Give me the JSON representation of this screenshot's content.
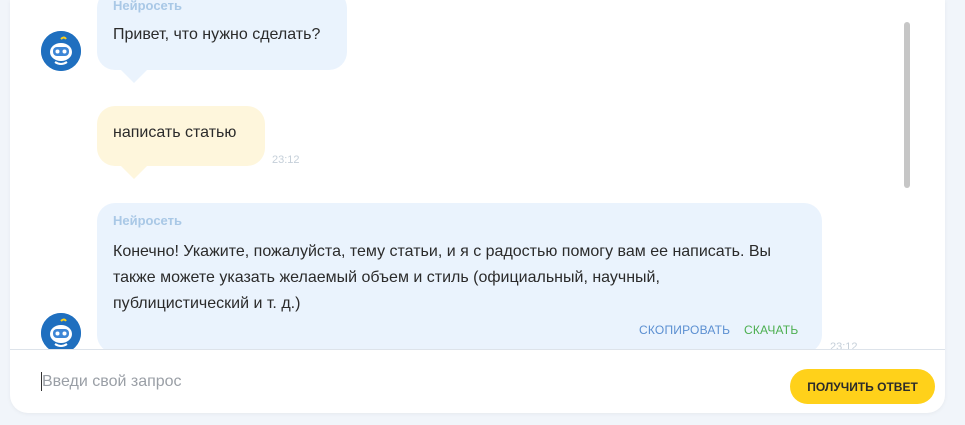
{
  "colors": {
    "bot_bubble": "#eaf3fd",
    "user_bubble": "#fef6dc",
    "copy_action": "#5b8fd1",
    "download_action": "#4caf50",
    "send_button": "#ffd11a"
  },
  "messages": [
    {
      "role": "bot",
      "sender": "Нейросеть",
      "text": "Привет, что нужно сделать?",
      "avatar_icon": "robot-avatar-icon"
    },
    {
      "role": "user",
      "text": "написать статью",
      "time": "23:12"
    },
    {
      "role": "bot",
      "sender": "Нейросеть",
      "text_lines": [
        "Конечно! Укажите, пожалуйста, тему статьи, и я с радостью помогу вам ее написать. Вы",
        "также можете указать желаемый объем и стиль (официальный, научный,",
        "публицистический и т. д.)"
      ],
      "copy_label": "Скопировать",
      "download_label": "Скачать",
      "time": "23:12",
      "avatar_icon": "robot-avatar-icon"
    }
  ],
  "input": {
    "placeholder": "Введи свой запрос",
    "value": ""
  },
  "send_button_label": "Получить ответ"
}
